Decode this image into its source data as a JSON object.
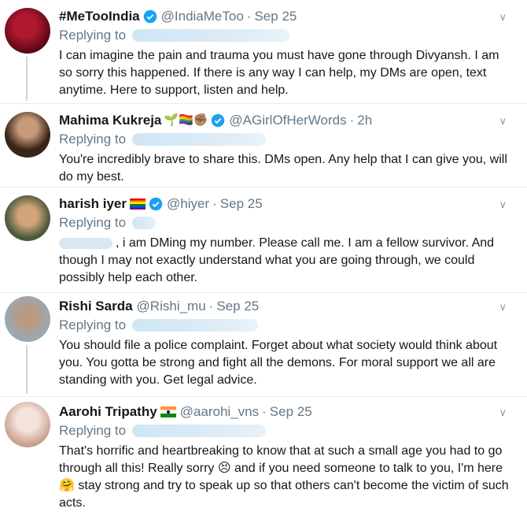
{
  "tweets": [
    {
      "name": "#MeTooIndia",
      "handle": "@IndiaMeToo",
      "time": "Sep 25",
      "reply_label": "Replying to",
      "text": "I can imagine the pain and trauma you must have gone through Divyansh. I am so sorry this happened. If there is any way I can help, my DMs are open, text anytime. Here to support, listen and help.",
      "avatar_color": "#7a0d1a"
    },
    {
      "name": "Mahima Kukreja",
      "emojis": "🌱🏳️‍🌈✊🏽",
      "handle": "@AGirlOfHerWords",
      "time": "2h",
      "reply_label": "Replying to",
      "text": "You're incredibly brave to share this. DMs open. Any help that I can give you, will do my best.",
      "avatar_color": "#6b4b3a"
    },
    {
      "name": "harish iyer",
      "handle": "@hiyer",
      "time": "Sep 25",
      "reply_label": "Replying to",
      "text": ", i am DMing my number. Please call me. I am a fellow survivor. And though I may not exactly understand what you are going through, we could possibly help each other.",
      "avatar_color": "#8a6a45"
    },
    {
      "name": "Rishi Sarda",
      "handle": "@Rishi_mu",
      "time": "Sep 25",
      "reply_label": "Replying to",
      "text": "You should file a police complaint. Forget about what society would think about you. You gotta be strong and fight all the demons. For moral support we all are standing with you. Get legal advice.",
      "avatar_color": "#8c9aa6"
    },
    {
      "name": "Aarohi Tripathy",
      "handle": "@aarohi_vns",
      "time": "Sep 25",
      "reply_label": "Replying to",
      "text": "That's horrific and heartbreaking to know that at such a small age you had to go through all this! Really sorry 😣 and if you need someone to talk to you, I'm here🤗 stay strong and try to speak up so that others can't become the victim of such acts.",
      "avatar_color": "#e8d6cc"
    }
  ],
  "colors": {
    "verified": "#1da1f2",
    "secondary": "#657786",
    "thread_line": "#ccd6dd"
  },
  "icons": {
    "verified": "verified-badge-icon",
    "menu": "chevron-down-icon"
  }
}
